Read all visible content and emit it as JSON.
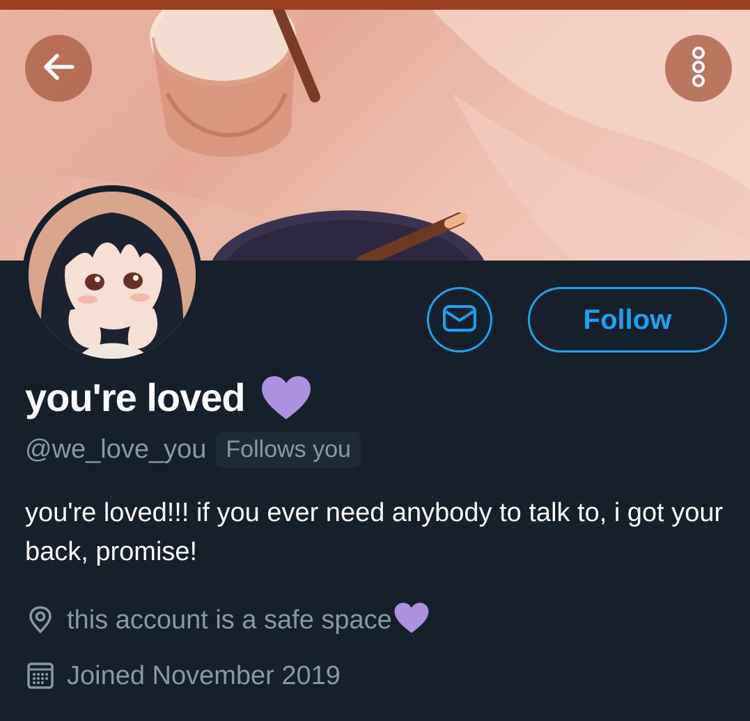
{
  "header": {
    "back_icon": "arrow-left-icon",
    "more_icon": "more-vertical-icon"
  },
  "profile": {
    "display_name": "you're loved",
    "name_emoji": "purple-heart",
    "handle": "@we_love_you",
    "follows_you_badge": "Follows you",
    "bio": "you're loved!!! if you ever need anybody to talk to, i got your back, promise!",
    "location": "this account is a safe space",
    "location_emoji": "purple-heart",
    "joined": "Joined November 2019"
  },
  "actions": {
    "message_icon": "envelope-icon",
    "follow_label": "Follow"
  },
  "colors": {
    "accent": "#1da1f2",
    "background": "#15202b",
    "secondary_text": "#8899a6",
    "heart": "#ac91e0",
    "banner_top_strip": "#9a3f22"
  }
}
